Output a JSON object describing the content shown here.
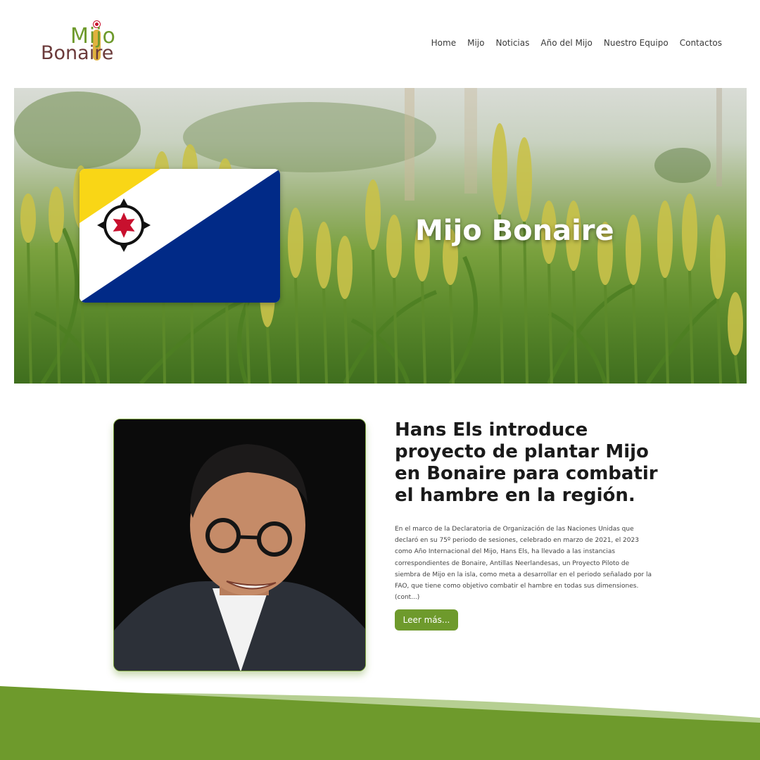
{
  "logo": {
    "line1": "Mijo",
    "line2": "Bonaire"
  },
  "nav": {
    "items": [
      {
        "label": "Home"
      },
      {
        "label": "Mijo"
      },
      {
        "label": "Noticias"
      },
      {
        "label": "Año del Mijo"
      },
      {
        "label": "Nuestro Equipo"
      },
      {
        "label": "Contactos"
      }
    ]
  },
  "hero": {
    "title": "Mijo Bonaire"
  },
  "article": {
    "headline": "Hans Els introduce proyecto de plantar Mijo en Bonaire para combatir el hambre en la región.",
    "body": "En el marco de la Declaratoria de Organización de las Naciones Unidas que declaró en su 75º periodo de sesiones, celebrado en marzo de 2021, el 2023 como Año Internacional del Mijo, Hans Els, ha llevado a las instancias correspondientes de Bonaire, Antillas Neerlandesas, un Proyecto Piloto de siembra de Mijo en la isla, como meta a desarrollar en el periodo señalado por la FAO, que tiene como objetivo combatir el hambre en todas sus dimensiones. (cont...)",
    "button_label": "Leer más..."
  },
  "colors": {
    "brand_green": "#6e9a2c",
    "brand_brown": "#6b3a3a",
    "flag_yellow": "#f9d616",
    "flag_blue": "#012a87",
    "flag_red": "#c8102e"
  }
}
